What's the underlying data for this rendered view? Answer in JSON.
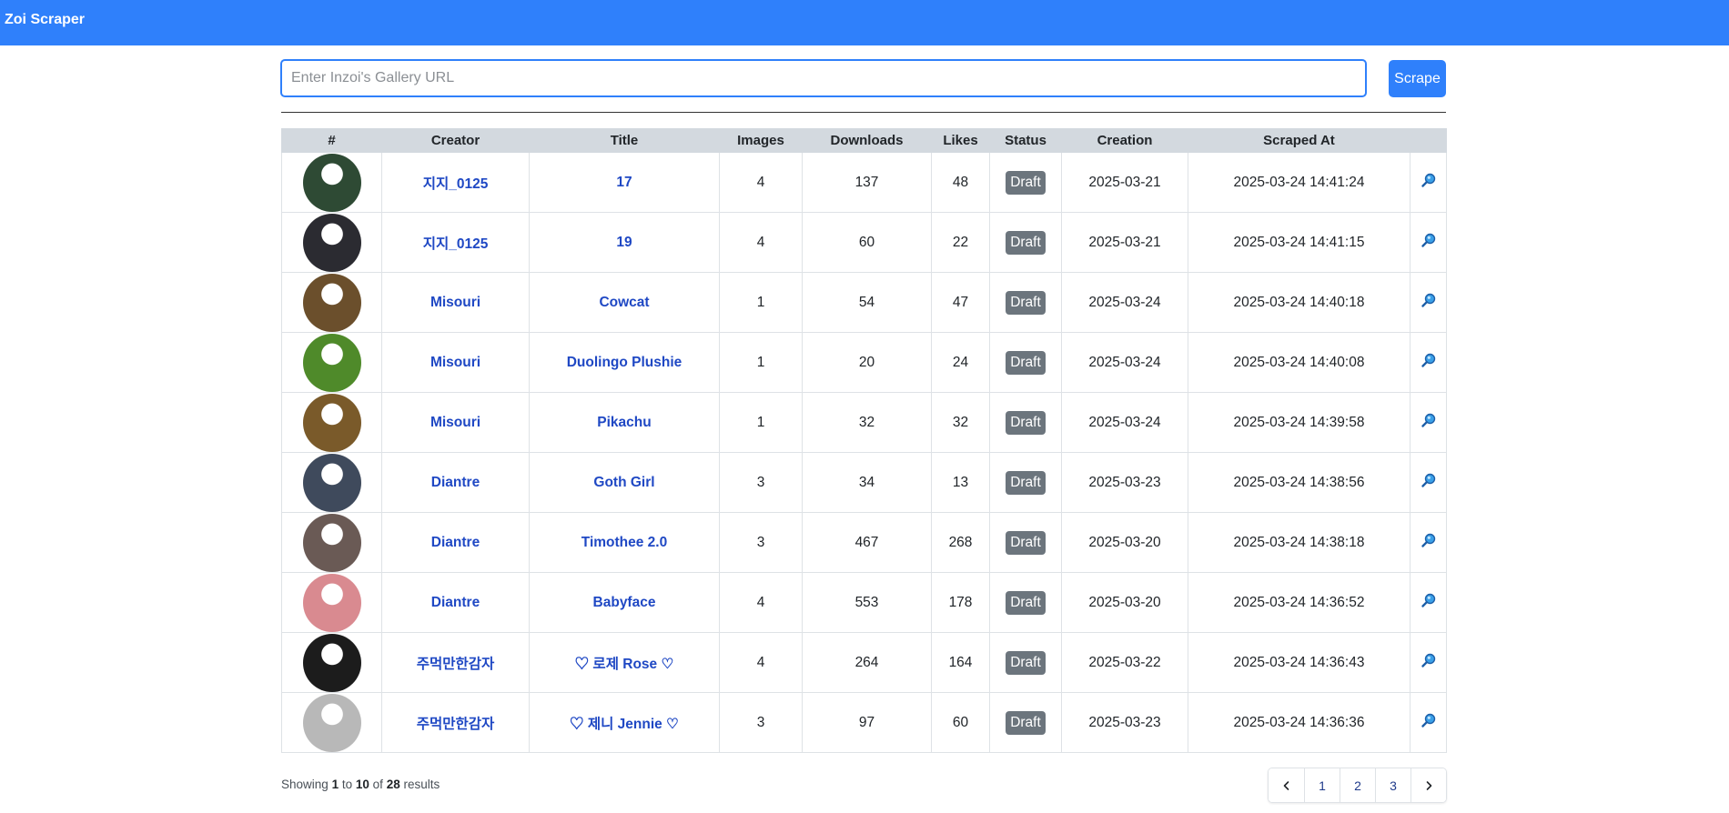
{
  "app": {
    "title": "Zoi Scraper"
  },
  "search": {
    "placeholder": "Enter Inzoi's Gallery URL",
    "button_label": "Scrape"
  },
  "table": {
    "columns": [
      "#",
      "Creator",
      "Title",
      "Images",
      "Downloads",
      "Likes",
      "Status",
      "Creation",
      "Scraped At",
      ""
    ],
    "rows": [
      {
        "avatar_color": "#2e4a34",
        "creator": "지지_0125",
        "title": "17",
        "images": "4",
        "downloads": "137",
        "likes": "48",
        "status": "Draft",
        "creation": "2025-03-21",
        "scraped_at": "2025-03-24 14:41:24"
      },
      {
        "avatar_color": "#2b2b31",
        "creator": "지지_0125",
        "title": "19",
        "images": "4",
        "downloads": "60",
        "likes": "22",
        "status": "Draft",
        "creation": "2025-03-21",
        "scraped_at": "2025-03-24 14:41:15"
      },
      {
        "avatar_color": "#6b4f2c",
        "creator": "Misouri",
        "title": "Cowcat",
        "images": "1",
        "downloads": "54",
        "likes": "47",
        "status": "Draft",
        "creation": "2025-03-24",
        "scraped_at": "2025-03-24 14:40:18"
      },
      {
        "avatar_color": "#4f8a2a",
        "creator": "Misouri",
        "title": "Duolingo Plushie",
        "images": "1",
        "downloads": "20",
        "likes": "24",
        "status": "Draft",
        "creation": "2025-03-24",
        "scraped_at": "2025-03-24 14:40:08"
      },
      {
        "avatar_color": "#7a5a2a",
        "creator": "Misouri",
        "title": "Pikachu",
        "images": "1",
        "downloads": "32",
        "likes": "32",
        "status": "Draft",
        "creation": "2025-03-24",
        "scraped_at": "2025-03-24 14:39:58"
      },
      {
        "avatar_color": "#3f4a5c",
        "creator": "Diantre",
        "title": "Goth Girl",
        "images": "3",
        "downloads": "34",
        "likes": "13",
        "status": "Draft",
        "creation": "2025-03-23",
        "scraped_at": "2025-03-24 14:38:56"
      },
      {
        "avatar_color": "#6a5a55",
        "creator": "Diantre",
        "title": "Timothee 2.0",
        "images": "3",
        "downloads": "467",
        "likes": "268",
        "status": "Draft",
        "creation": "2025-03-20",
        "scraped_at": "2025-03-24 14:38:18"
      },
      {
        "avatar_color": "#d98a90",
        "creator": "Diantre",
        "title": "Babyface",
        "images": "4",
        "downloads": "553",
        "likes": "178",
        "status": "Draft",
        "creation": "2025-03-20",
        "scraped_at": "2025-03-24 14:36:52"
      },
      {
        "avatar_color": "#1c1c1c",
        "creator": "주먹만한감자",
        "title": "♡ 로제 Rose ♡",
        "images": "4",
        "downloads": "264",
        "likes": "164",
        "status": "Draft",
        "creation": "2025-03-22",
        "scraped_at": "2025-03-24 14:36:43"
      },
      {
        "avatar_color": "#b8b8b8",
        "creator": "주먹만한감자",
        "title": "♡ 제니 Jennie ♡",
        "images": "3",
        "downloads": "97",
        "likes": "60",
        "status": "Draft",
        "creation": "2025-03-23",
        "scraped_at": "2025-03-24 14:36:36"
      }
    ]
  },
  "footer": {
    "prefix": "Showing",
    "from": "1",
    "to_word": "to",
    "to": "10",
    "of_word": "of",
    "total": "28",
    "suffix": "results"
  },
  "pagination": {
    "pages": [
      "1",
      "2",
      "3"
    ],
    "prev_icon": "chevron-left-icon",
    "next_icon": "chevron-right-icon"
  },
  "icons": {
    "view": "magnifier-icon"
  },
  "colors": {
    "accent": "#2f80fb",
    "link": "#1f48c4",
    "badge": "#6c757d",
    "header_bg": "#d3d9df"
  }
}
